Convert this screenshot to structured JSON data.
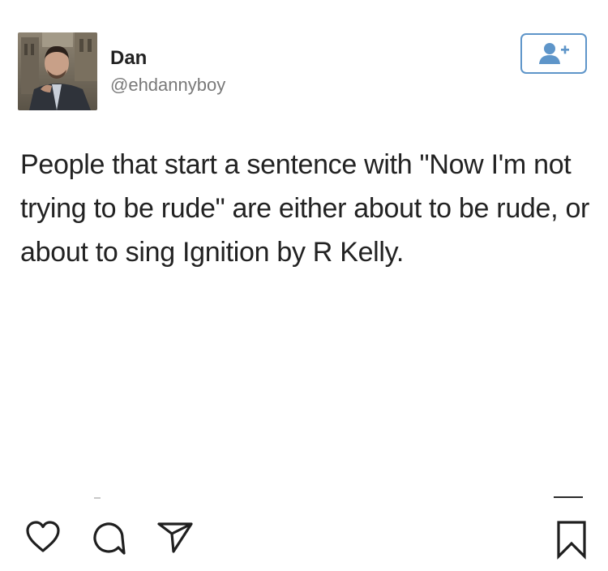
{
  "post": {
    "author": {
      "name": "Dan",
      "handle": "@ehdannyboy"
    },
    "text": "People that start a sentence with \"Now I'm not trying to be rude\" are either about to be rude, or about to sing Ignition by R Kelly."
  },
  "icons": {
    "follow": "add-user-icon",
    "like": "heart-icon",
    "comment": "comment-icon",
    "share": "share-icon",
    "save": "bookmark-icon"
  },
  "colors": {
    "follow_accent": "#5e95c9",
    "text": "#222222",
    "handle": "#7a7a7a"
  }
}
